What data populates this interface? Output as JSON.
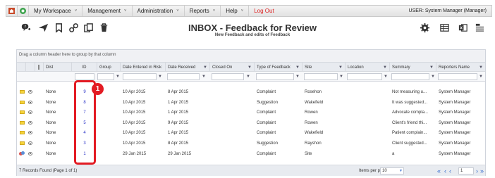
{
  "menubar": {
    "items": [
      {
        "label": "My Workspace",
        "caret": "˅"
      },
      {
        "label": "Management",
        "caret": "˅"
      },
      {
        "label": "Administration",
        "caret": "˅"
      },
      {
        "label": "Reports",
        "caret": "˅"
      },
      {
        "label": "Help",
        "caret": "˅"
      }
    ],
    "logout": "Log Out",
    "user": "USER: System Manager (Manager)"
  },
  "toolbar": {
    "icons": [
      "add-feedback-icon",
      "send-icon",
      "bookmark-icon",
      "link-icon",
      "copy-icon",
      "delete-icon",
      "settings-icon",
      "grid-view-icon",
      "excel-export-icon",
      "columns-icon"
    ]
  },
  "page": {
    "title": "INBOX - Feedback for Review",
    "subtitle": "New Feedback and edits of Feedback"
  },
  "grid": {
    "group_hint": "Drag a column header here to group by that column",
    "columns": [
      "",
      "",
      "Dist",
      "ID",
      "Group",
      "Date Entered in Risk",
      "Date Received",
      "Closed On",
      "Type of Feedback",
      "Site",
      "Location",
      "Summary",
      "Reporters Name"
    ],
    "rows": [
      {
        "dist": "None",
        "id": "9",
        "entered": "10 Apr 2015",
        "received": "8 Apr 2015",
        "closed": "",
        "type": "Complaint",
        "site": "Rosehon",
        "location": "",
        "summary": "Not measuring u...",
        "reporter": "System Manager",
        "icon": "envelope"
      },
      {
        "dist": "None",
        "id": "8",
        "entered": "10 Apr 2015",
        "received": "1 Apr 2015",
        "closed": "",
        "type": "Suggestion",
        "site": "Wakefield",
        "location": "",
        "summary": "It was suggested...",
        "reporter": "System Manager",
        "icon": "envelope"
      },
      {
        "dist": "None",
        "id": "7",
        "entered": "10 Apr 2015",
        "received": "1 Apr 2015",
        "closed": "",
        "type": "Complaint",
        "site": "Rowen",
        "location": "",
        "summary": "Advocate compla...",
        "reporter": "System Manager",
        "icon": "envelope"
      },
      {
        "dist": "None",
        "id": "5",
        "entered": "10 Apr 2015",
        "received": "9 Apr 2015",
        "closed": "",
        "type": "Complaint",
        "site": "Rowen",
        "location": "",
        "summary": "Client's friend thi...",
        "reporter": "System Manager",
        "icon": "envelope"
      },
      {
        "dist": "None",
        "id": "4",
        "entered": "10 Apr 2015",
        "received": "1 Apr 2015",
        "closed": "",
        "type": "Complaint",
        "site": "Wakefield",
        "location": "",
        "summary": "Patient complain...",
        "reporter": "System Manager",
        "icon": "envelope"
      },
      {
        "dist": "None",
        "id": "3",
        "entered": "10 Apr 2015",
        "received": "8 Apr 2015",
        "closed": "",
        "type": "Suggestion",
        "site": "Rayshon",
        "location": "",
        "summary": "Client suggested...",
        "reporter": "System Manager",
        "icon": "envelope"
      },
      {
        "dist": "None",
        "id": "1",
        "entered": "29 Jan 2015",
        "received": "29 Jan 2015",
        "closed": "",
        "type": "Complaint",
        "site": "Site",
        "location": "",
        "summary": "a",
        "reporter": "System Manager",
        "icon": "people"
      }
    ],
    "footer": {
      "records": "7 Records Found (Page 1 of 1)",
      "items_per_page_label": "Items per page:",
      "items_per_page": "10",
      "page": "1"
    }
  },
  "annotation": {
    "callout_number": "1"
  },
  "colors": {
    "highlight": "#e31b23",
    "id_link": "#2a33c8",
    "logout": "#dd2222",
    "pager": "#3a6fd0"
  }
}
